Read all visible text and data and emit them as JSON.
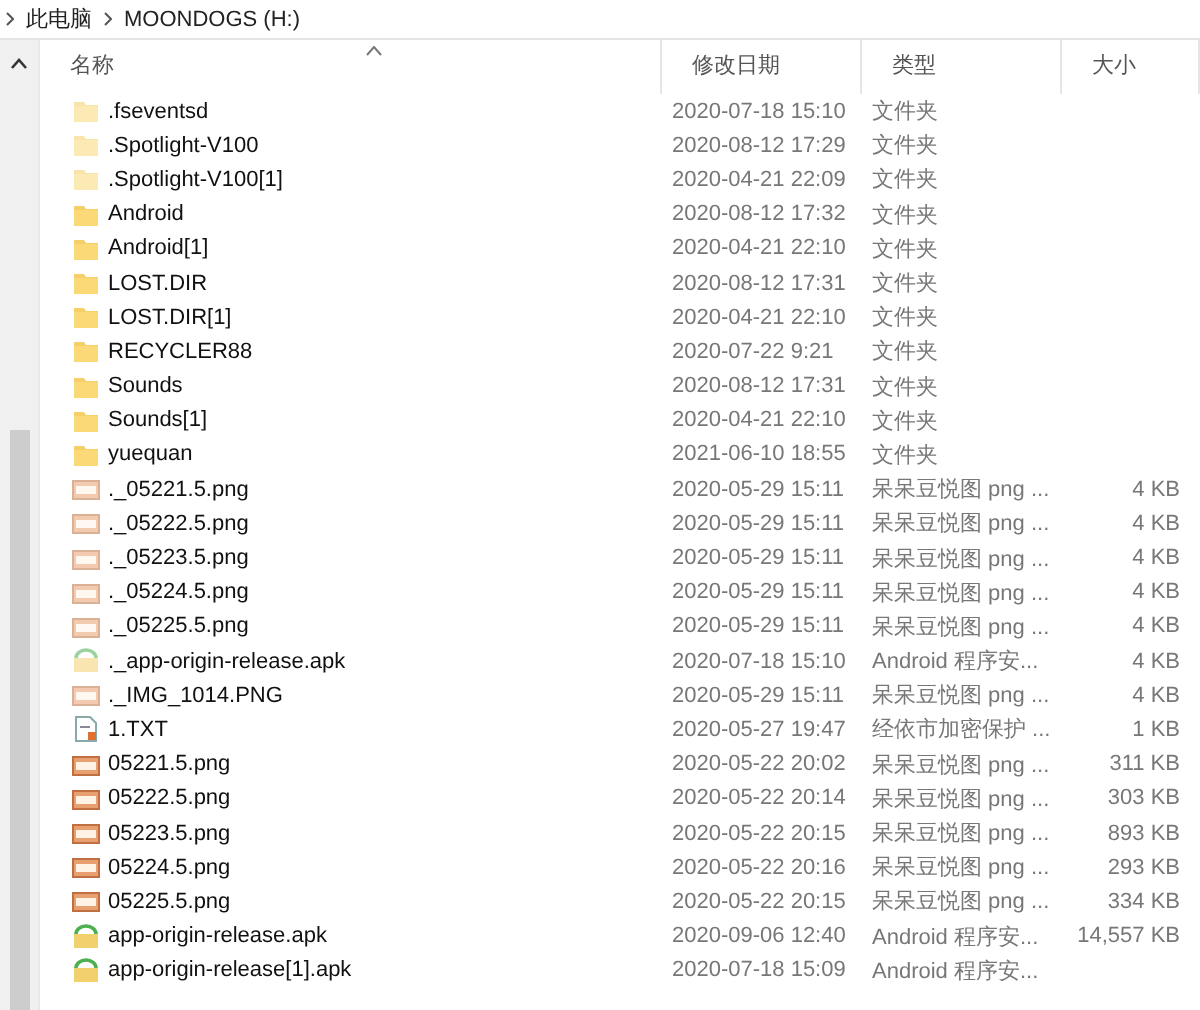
{
  "breadcrumb": [
    {
      "label": "此电脑"
    },
    {
      "label": "MOONDOGS (H:)"
    }
  ],
  "columns": [
    {
      "label": "名称",
      "sorted": true
    },
    {
      "label": "修改日期",
      "sorted": false
    },
    {
      "label": "类型",
      "sorted": false
    },
    {
      "label": "大小",
      "sorted": false
    }
  ],
  "rows": [
    {
      "kind": "folder",
      "hidden": true,
      "name": ".fseventsd",
      "modified": "2020-07-18 15:10",
      "type": "文件夹"
    },
    {
      "kind": "folder",
      "hidden": true,
      "name": ".Spotlight-V100",
      "modified": "2020-08-12 17:29",
      "type": "文件夹"
    },
    {
      "kind": "folder",
      "hidden": true,
      "name": ".Spotlight-V100[1]",
      "modified": "2020-04-21 22:09",
      "type": "文件夹"
    },
    {
      "kind": "folder",
      "hidden": false,
      "name": "Android",
      "modified": "2020-08-12 17:32",
      "type": "文件夹"
    },
    {
      "kind": "folder",
      "hidden": false,
      "name": "Android[1]",
      "modified": "2020-04-21 22:10",
      "type": "文件夹"
    },
    {
      "kind": "folder",
      "hidden": false,
      "name": "LOST.DIR",
      "modified": "2020-08-12 17:31",
      "type": "文件夹"
    },
    {
      "kind": "folder",
      "hidden": false,
      "name": "LOST.DIR[1]",
      "modified": "2020-04-21 22:10",
      "type": "文件夹"
    },
    {
      "kind": "folder",
      "hidden": false,
      "name": "RECYCLER88",
      "modified": "2020-07-22 9:21",
      "type": "文件夹"
    },
    {
      "kind": "folder",
      "hidden": false,
      "name": "Sounds",
      "modified": "2020-08-12 17:31",
      "type": "文件夹"
    },
    {
      "kind": "folder",
      "hidden": false,
      "name": "Sounds[1]",
      "modified": "2020-04-21 22:10",
      "type": "文件夹"
    },
    {
      "kind": "folder",
      "hidden": false,
      "name": "yuequan",
      "modified": "2021-06-10 18:55",
      "type": "文件夹"
    },
    {
      "kind": "image",
      "hidden": true,
      "name": "._05221.5.png",
      "modified": "2020-05-29 15:11",
      "type": "呆呆豆悦图 png ...",
      "size": "4 KB"
    },
    {
      "kind": "image",
      "hidden": true,
      "name": "._05222.5.png",
      "modified": "2020-05-29 15:11",
      "type": "呆呆豆悦图 png ...",
      "size": "4 KB"
    },
    {
      "kind": "image",
      "hidden": true,
      "name": "._05223.5.png",
      "modified": "2020-05-29 15:11",
      "type": "呆呆豆悦图 png ...",
      "size": "4 KB"
    },
    {
      "kind": "image",
      "hidden": true,
      "name": "._05224.5.png",
      "modified": "2020-05-29 15:11",
      "type": "呆呆豆悦图 png ...",
      "size": "4 KB"
    },
    {
      "kind": "image",
      "hidden": true,
      "name": "._05225.5.png",
      "modified": "2020-05-29 15:11",
      "type": "呆呆豆悦图 png ...",
      "size": "4 KB"
    },
    {
      "kind": "apk",
      "hidden": true,
      "name": "._app-origin-release.apk",
      "modified": "2020-07-18 15:10",
      "type": "Android 程序安...",
      "size": "4 KB"
    },
    {
      "kind": "image",
      "hidden": true,
      "name": "._IMG_1014.PNG",
      "modified": "2020-05-29 15:11",
      "type": "呆呆豆悦图 png ...",
      "size": "4 KB"
    },
    {
      "kind": "text",
      "hidden": false,
      "name": "1.TXT",
      "modified": "2020-05-27 19:47",
      "type": "经依市加密保护 ...",
      "size": "1 KB"
    },
    {
      "kind": "image",
      "hidden": false,
      "name": "05221.5.png",
      "modified": "2020-05-22 20:02",
      "type": "呆呆豆悦图 png ...",
      "size": "311 KB"
    },
    {
      "kind": "image",
      "hidden": false,
      "name": "05222.5.png",
      "modified": "2020-05-22 20:14",
      "type": "呆呆豆悦图 png ...",
      "size": "303 KB"
    },
    {
      "kind": "image",
      "hidden": false,
      "name": "05223.5.png",
      "modified": "2020-05-22 20:15",
      "type": "呆呆豆悦图 png ...",
      "size": "893 KB"
    },
    {
      "kind": "image",
      "hidden": false,
      "name": "05224.5.png",
      "modified": "2020-05-22 20:16",
      "type": "呆呆豆悦图 png ...",
      "size": "293 KB"
    },
    {
      "kind": "image",
      "hidden": false,
      "name": "05225.5.png",
      "modified": "2020-05-22 20:15",
      "type": "呆呆豆悦图 png ...",
      "size": "334 KB"
    },
    {
      "kind": "apk",
      "hidden": false,
      "name": "app-origin-release.apk",
      "modified": "2020-09-06 12:40",
      "type": "Android 程序安...",
      "size": "14,557 KB"
    },
    {
      "kind": "apk",
      "hidden": false,
      "name": "app-origin-release[1].apk",
      "modified": "2020-07-18 15:09",
      "type": "Android 程序安..."
    }
  ]
}
